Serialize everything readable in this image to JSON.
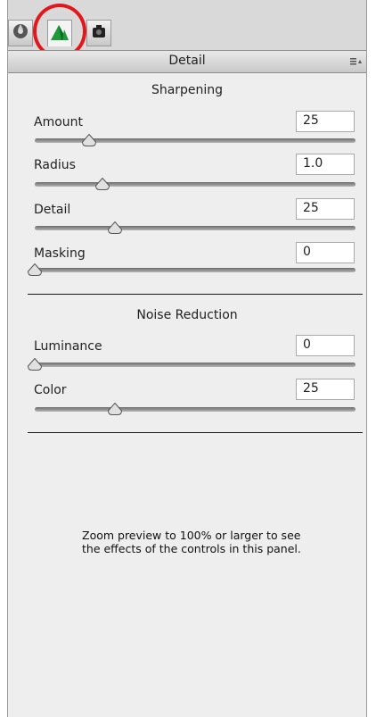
{
  "header": {
    "title": "Detail"
  },
  "tabs": [
    {
      "icon": "basic-tonecurve-icon"
    },
    {
      "icon": "detail-triangle-icon",
      "active": true
    },
    {
      "icon": "camera-calibration-icon"
    }
  ],
  "sharpening": {
    "title": "Sharpening",
    "amount": {
      "label": "Amount",
      "value": "25",
      "fraction": 0.17
    },
    "radius": {
      "label": "Radius",
      "value": "1.0",
      "fraction": 0.21
    },
    "detail": {
      "label": "Detail",
      "value": "25",
      "fraction": 0.25
    },
    "masking": {
      "label": "Masking",
      "value": "0",
      "fraction": 0.0
    }
  },
  "noise_reduction": {
    "title": "Noise Reduction",
    "luminance": {
      "label": "Luminance",
      "value": "0",
      "fraction": 0.0
    },
    "color": {
      "label": "Color",
      "value": "25",
      "fraction": 0.25
    }
  },
  "note": "Zoom preview to 100% or larger to see the effects of the controls in this panel.",
  "colors": {
    "highlight_ring": "#e2161b",
    "active_icon": "#1e9a3a"
  }
}
